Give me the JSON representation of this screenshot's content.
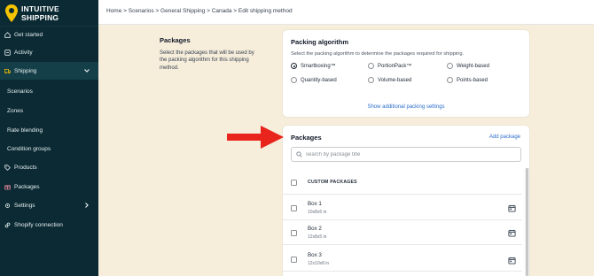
{
  "brand": {
    "line1": "INTUITIVE",
    "line2": "SHIPPING",
    "logo_color": "#f5c400"
  },
  "sidebar": {
    "items": [
      {
        "label": "Get started",
        "icon": "home-icon"
      },
      {
        "label": "Activity",
        "icon": "activity-icon"
      },
      {
        "label": "Shipping",
        "icon": "truck-icon",
        "expanded": true
      },
      {
        "label": "Scenarios"
      },
      {
        "label": "Zones"
      },
      {
        "label": "Rate blending"
      },
      {
        "label": "Condition groups"
      },
      {
        "label": "Products",
        "icon": "tag-icon"
      },
      {
        "label": "Packages",
        "icon": "package-icon"
      },
      {
        "label": "Settings",
        "icon": "gear-icon"
      },
      {
        "label": "Shopify connection",
        "icon": "link-icon"
      }
    ]
  },
  "breadcrumb": "Home > Scenarios > General Shipping > Canada > Edit shipping method",
  "section": {
    "title": "Packages",
    "description": "Select the packages that will be used by the packing algorithm for this shipping method."
  },
  "algorithm": {
    "title": "Packing algorithm",
    "subtitle": "Select the packing algorithm to determine the packages required for shipping.",
    "options": [
      "Smartboxing™",
      "PortionPack™",
      "Weight-based",
      "Quantity-based",
      "Volume-based",
      "Points-based"
    ],
    "selected": "Smartboxing™",
    "more_link": "Show additional packing settings"
  },
  "packages": {
    "title": "Packages",
    "add_label": "Add package",
    "search_placeholder": "search by package title",
    "column_header": "CUSTOM PACKAGES",
    "rows": [
      {
        "name": "Box 1",
        "dims": "10x8x5 in"
      },
      {
        "name": "Box 2",
        "dims": "12x8x5 in"
      },
      {
        "name": "Box 3",
        "dims": "12x10x8 in"
      }
    ]
  },
  "colors": {
    "sidebar": "#0b2a33",
    "background": "#f6eedb",
    "link": "#2c6ecb",
    "arrow": "#e8241c"
  }
}
